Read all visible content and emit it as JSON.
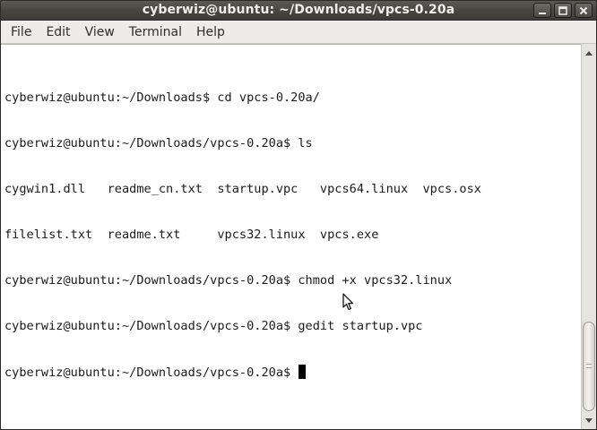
{
  "window": {
    "title": "cyberwiz@ubuntu: ~/Downloads/vpcs-0.20a",
    "buttons": {
      "minimize_icon": "minimize-icon",
      "maximize_icon": "maximize-icon",
      "close_icon": "close-icon"
    }
  },
  "menubar": {
    "items": [
      {
        "label": "File"
      },
      {
        "label": "Edit"
      },
      {
        "label": "View"
      },
      {
        "label": "Terminal"
      },
      {
        "label": "Help"
      }
    ]
  },
  "terminal": {
    "lines": [
      "cyberwiz@ubuntu:~/Downloads$ cd vpcs-0.20a/",
      "cyberwiz@ubuntu:~/Downloads/vpcs-0.20a$ ls",
      "cygwin1.dll   readme_cn.txt  startup.vpc   vpcs64.linux  vpcs.osx",
      "filelist.txt  readme.txt     vpcs32.linux  vpcs.exe",
      "cyberwiz@ubuntu:~/Downloads/vpcs-0.20a$ chmod +x vpcs32.linux",
      "cyberwiz@ubuntu:~/Downloads/vpcs-0.20a$ gedit startup.vpc"
    ],
    "prompt": "cyberwiz@ubuntu:~/Downloads/vpcs-0.20a$ "
  },
  "scrollbar": {
    "position_fraction": 1.0
  },
  "colors": {
    "titlebar": "#3c3b37",
    "terminal_bg": "#ffffff",
    "terminal_fg": "#1a1a1a"
  }
}
